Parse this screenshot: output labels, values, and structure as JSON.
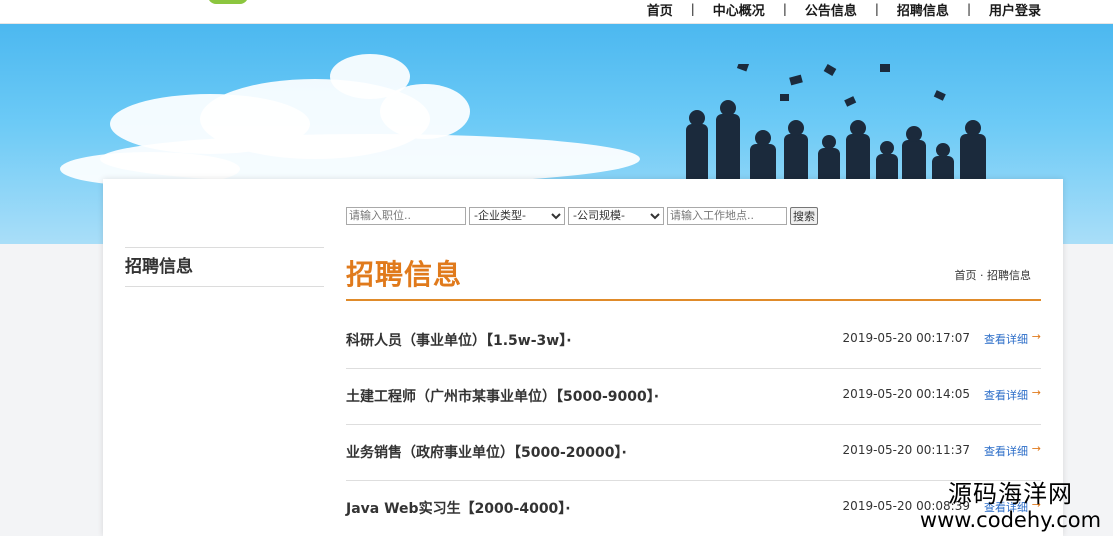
{
  "nav": {
    "items": [
      {
        "label": "首页"
      },
      {
        "label": "中心概况"
      },
      {
        "label": "公告信息"
      },
      {
        "label": "招聘信息"
      },
      {
        "label": "用户登录"
      }
    ],
    "separator": "|"
  },
  "sidebar": {
    "title": "招聘信息"
  },
  "search": {
    "position_placeholder": "请输入职位..",
    "company_type": "-企业类型-",
    "company_size": "-公司规模-",
    "location_placeholder": "请输入工作地点..",
    "search_label": "搜索"
  },
  "main": {
    "heading": "招聘信息",
    "breadcrumb": "首页 · 招聘信息"
  },
  "jobs": [
    {
      "title": "科研人员（事业单位）【1.5w-3w】·",
      "date": "2019-05-20 00:17:07",
      "more": "查看详细"
    },
    {
      "title": "土建工程师（广州市某事业单位）【5000-9000】·",
      "date": "2019-05-20 00:14:05",
      "more": "查看详细"
    },
    {
      "title": "业务销售（政府事业单位）【5000-20000】·",
      "date": "2019-05-20 00:11:37",
      "more": "查看详细"
    },
    {
      "title": "Java Web实习生【2000-4000】·",
      "date": "2019-05-20 00:08:39",
      "more": "查看详细"
    }
  ],
  "arrow_glyph": "→",
  "watermark": {
    "line1": "源码海洋网",
    "line2": "www.codehy.com"
  },
  "colors": {
    "accent": "#e07a1c",
    "link": "#2a6cc8",
    "banner_sky": "#4cb8f0"
  }
}
